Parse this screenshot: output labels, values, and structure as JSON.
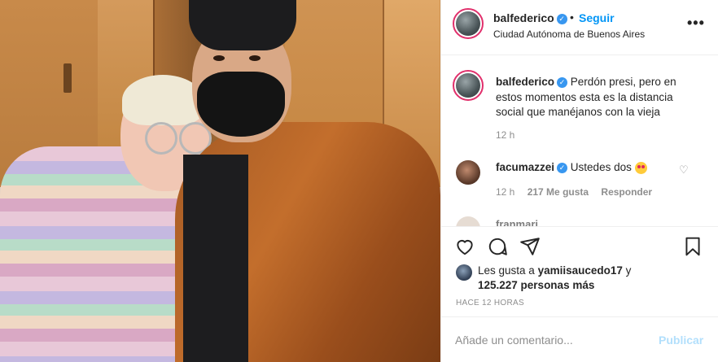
{
  "post": {
    "username": "balfederico",
    "follow_label": "Seguir",
    "separator": "•",
    "location": "Ciudad Autónoma de Buenos Aires",
    "more_label": "•••"
  },
  "caption": {
    "username": "balfederico",
    "text": "Perdón presi, pero en estos momentos esta es la distancia social que manéjanos con la vieja",
    "time": "12 h"
  },
  "comments": [
    {
      "username": "facumazzei",
      "text": "Ustedes dos",
      "time": "12 h",
      "likes": "217 Me gusta",
      "reply_label": "Responder"
    },
    {
      "username": "franmari..."
    }
  ],
  "likes": {
    "prefix": "Les gusta a",
    "user": "yamiisaucedo17",
    "conj": "y",
    "count": "125.227 personas más"
  },
  "time_ago": "HACE 12 HORAS",
  "add_comment": {
    "placeholder": "Añade un comentario...",
    "publish_label": "Publicar"
  },
  "icons": [
    "verified-icon",
    "more-icon",
    "heart-icon",
    "comment-icon",
    "share-icon",
    "bookmark-icon",
    "heart-eyes-emoji"
  ],
  "colors": {
    "accent": "#0095f6",
    "verified": "#3897f0",
    "muted": "#8e8e8e",
    "publish_disabled": "#b2dffc"
  }
}
